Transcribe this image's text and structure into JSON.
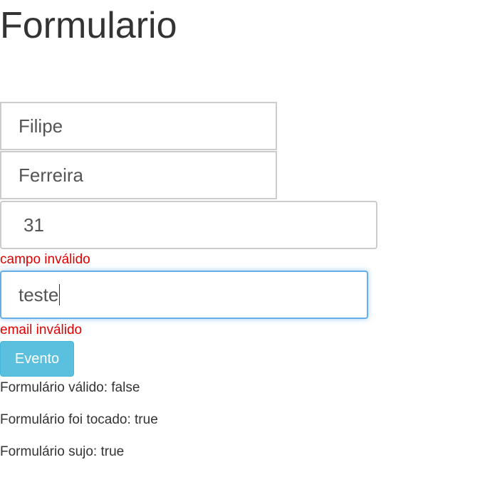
{
  "page": {
    "title": "Formulario"
  },
  "form": {
    "nome": {
      "value": "Filipe"
    },
    "sobrenome": {
      "value": "Ferreira"
    },
    "idade": {
      "value": "31",
      "error": "campo inválido"
    },
    "email": {
      "value": "teste",
      "error": "email inválido",
      "focused": true
    },
    "button_label": "Evento",
    "focus_color": "#66afe9",
    "error_color": "#e00000",
    "button_color": "#5bc0de"
  },
  "status": {
    "valid": "Formulário válido: false",
    "touched": "Formulário foi tocado: true",
    "dirty": "Formulário sujo: true"
  }
}
